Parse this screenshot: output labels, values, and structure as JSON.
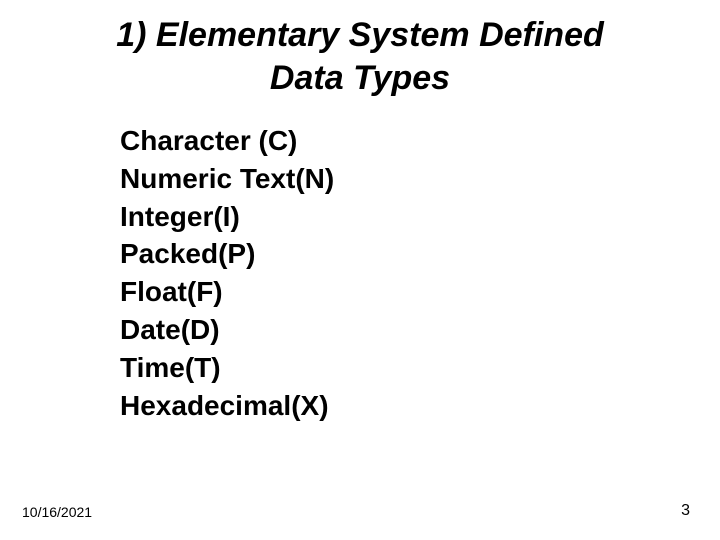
{
  "title": {
    "line1": "1) Elementary System Defined",
    "line2": "Data Types"
  },
  "items": [
    "Character (C)",
    "Numeric Text(N)",
    "Integer(I)",
    "Packed(P)",
    "Float(F)",
    "Date(D)",
    "Time(T)",
    "Hexadecimal(X)"
  ],
  "footer": {
    "date": "10/16/2021",
    "page": "3"
  }
}
